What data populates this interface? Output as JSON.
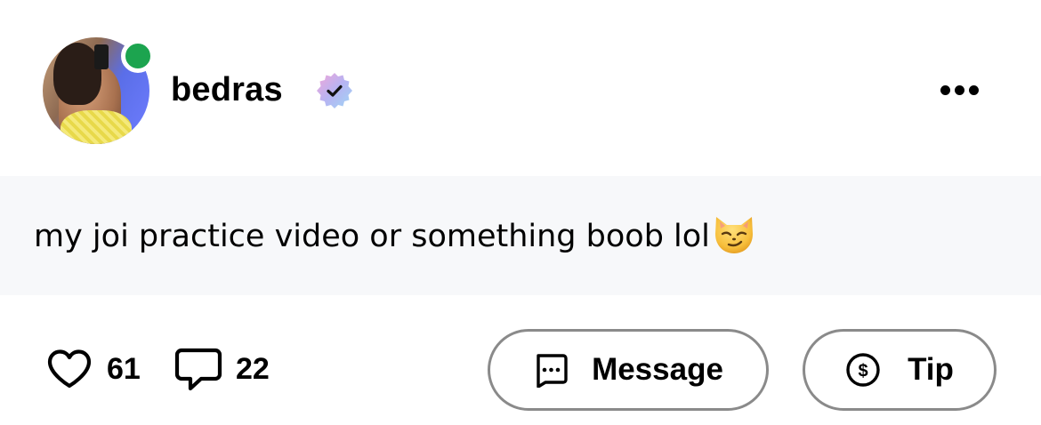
{
  "post": {
    "author": {
      "username": "bedras",
      "online": true,
      "verified": true,
      "avatar_icon": "profile-photo",
      "status_color": "#1ca44f"
    },
    "menu_icon": "more-horizontal-icon",
    "caption": {
      "text": "my joi practice video or something boob lol",
      "emoji": "smirking-cat-emoji"
    },
    "stats": {
      "likes": "61",
      "comments": "22"
    },
    "actions": {
      "message_label": "Message",
      "tip_label": "Tip"
    }
  },
  "colors": {
    "caption_background": "#f7f8fa",
    "button_border": "#8a8a8a"
  }
}
